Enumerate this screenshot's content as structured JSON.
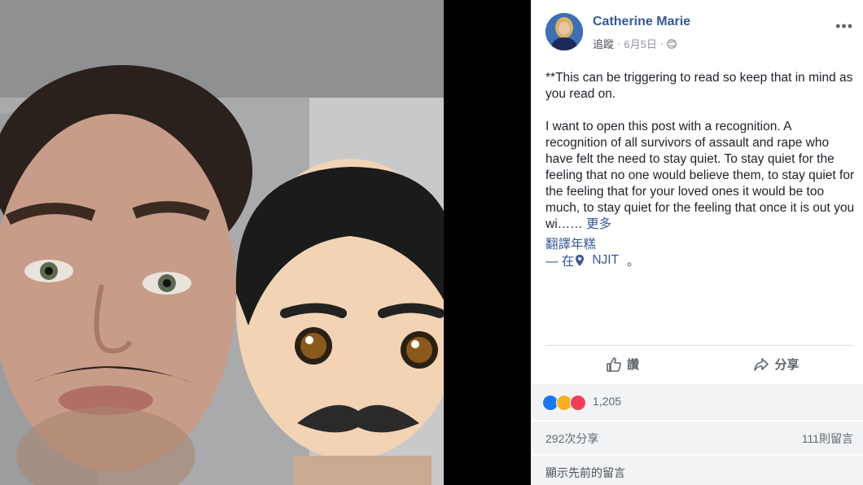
{
  "post": {
    "author": "Catherine Marie",
    "follow": "追蹤",
    "separator": "·",
    "date": "6月5日",
    "separator2": "·",
    "more": "•••",
    "paragraphs": [
      "**This can be triggering to read so keep that in mind as you read on.",
      "I want to open this post with a recognition. A recognition of all survivors of assault and rape who have felt the need to stay quiet. To stay quiet for the feeling that no one would believe them, to stay quiet for the feeling that for your loved ones it would be too much, to stay quiet for the feeling that once it is out you wi……"
    ],
    "see_more": "更多",
    "translate": "翻譯年糕",
    "location_prefix": "— 在",
    "location": "NJIT",
    "location_suffix": "。"
  },
  "actions": {
    "like": "讚",
    "share": "分享"
  },
  "reactions": {
    "count": "1,205",
    "colors": [
      "#1877f2",
      "#f7b125",
      "#f33e58"
    ]
  },
  "stats": {
    "shares": "292次分享",
    "comments": "111則留言"
  },
  "footer": {
    "previous_comments": "顯示先前的留言"
  }
}
